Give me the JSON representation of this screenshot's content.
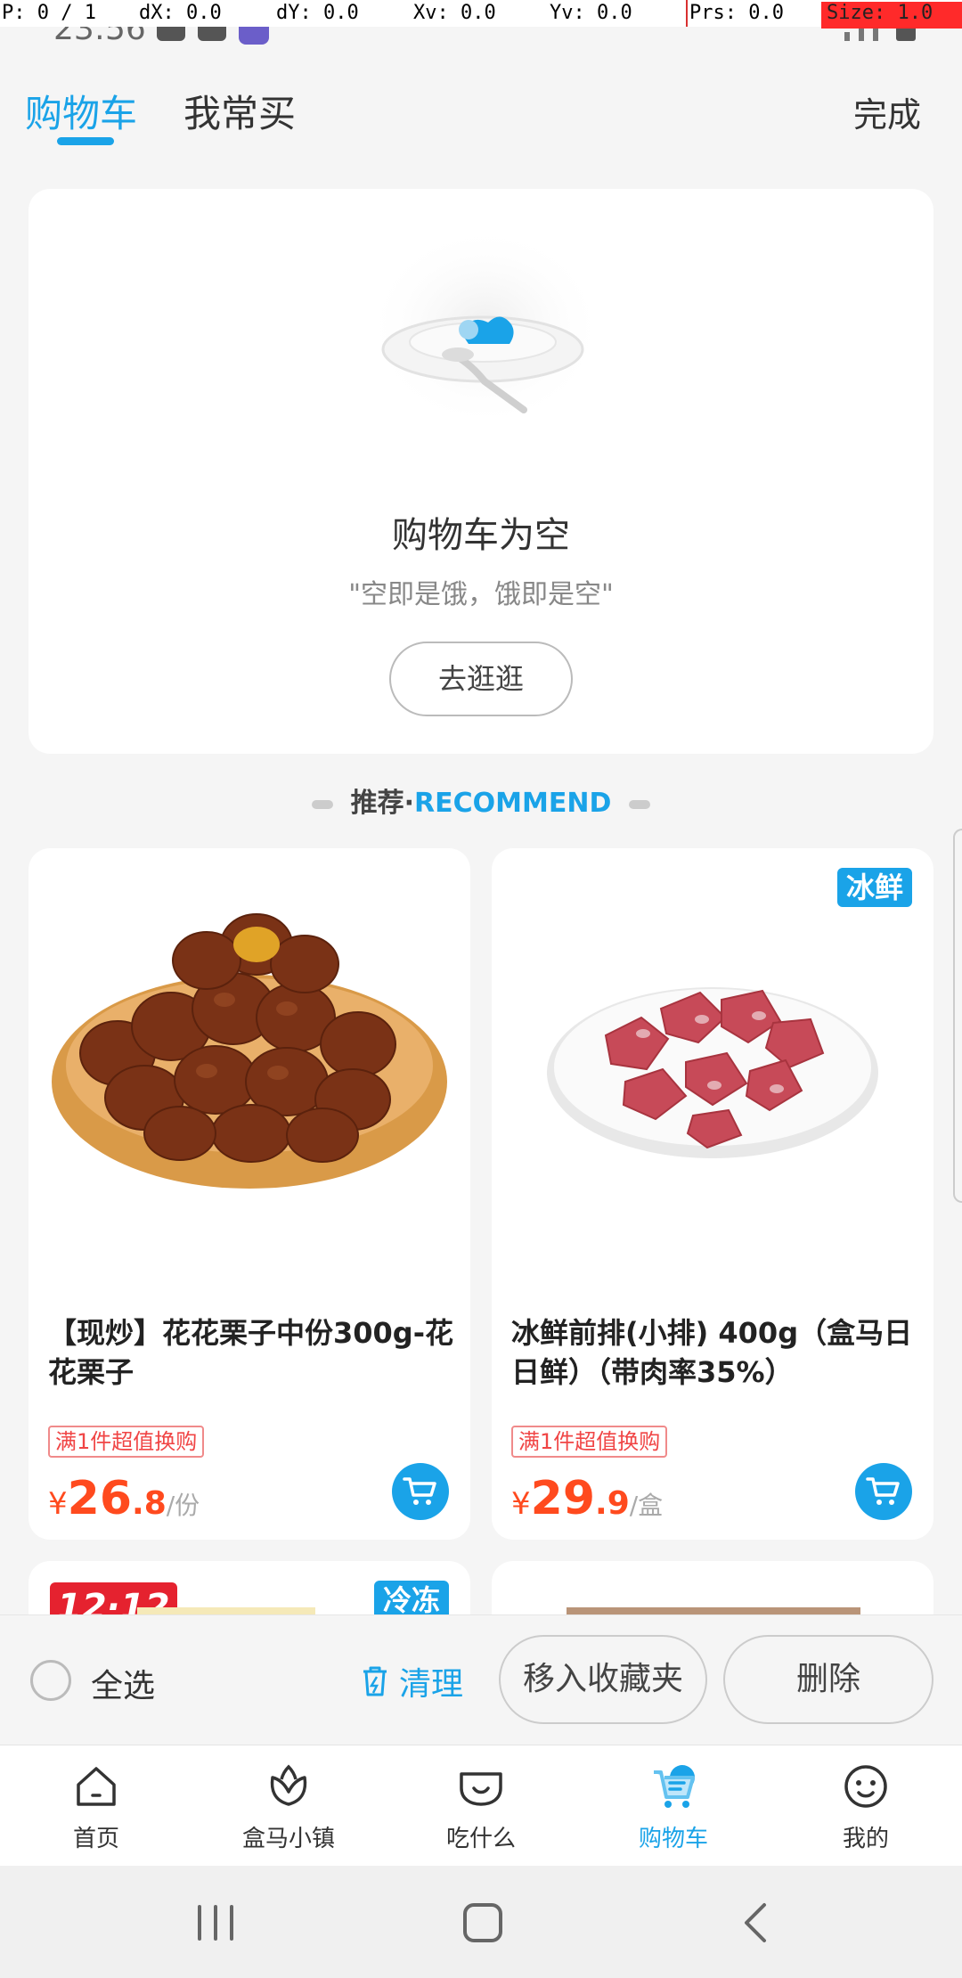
{
  "debug": {
    "p": "P: 0 / 1",
    "dx": "dX: 0.0",
    "dy": "dY: 0.0",
    "xv": "Xv: 0.0",
    "yv": "Yv: 0.0",
    "prs": "Prs: 0.0",
    "size": "Size: 1.0"
  },
  "status": {
    "time": "23:56"
  },
  "header": {
    "tab_cart": "购物车",
    "tab_frequent": "我常买",
    "done": "完成"
  },
  "empty_cart": {
    "title": "购物车为空",
    "subtitle": "\"空即是饿，饿即是空\"",
    "browse_button": "去逛逛"
  },
  "recommend": {
    "label_cn": "推荐·",
    "label_en": "RECOMMEND"
  },
  "products": [
    {
      "name": "【现炒】花花栗子中份300g-花花栗子",
      "promo": "满1件超值换购",
      "currency": "¥",
      "price_int": "26",
      "price_dec": ".8",
      "unit": "/份",
      "image_icon": "chestnut-image"
    },
    {
      "name": "冰鲜前排(小排) 400g（盒马日日鲜）（带肉率35%）",
      "badge": "冰鲜",
      "promo": "满1件超值换购",
      "currency": "¥",
      "price_int": "29",
      "price_dec": ".9",
      "unit": "/盒",
      "image_icon": "pork-ribs-image"
    },
    {
      "tag": "12·12",
      "badge": "冷冻"
    },
    {}
  ],
  "action_bar": {
    "select_all": "全选",
    "clean": "清理",
    "move_to_favorites": "移入收藏夹",
    "delete": "删除"
  },
  "bottom_nav": [
    {
      "label": "首页",
      "icon": "home-icon"
    },
    {
      "label": "盒马小镇",
      "icon": "town-icon"
    },
    {
      "label": "吃什么",
      "icon": "eat-icon"
    },
    {
      "label": "购物车",
      "icon": "cart-icon",
      "active": true
    },
    {
      "label": "我的",
      "icon": "profile-icon"
    }
  ],
  "colors": {
    "accent": "#1aa3e8",
    "price": "#ff4a1e",
    "promo_border": "#f08a8a",
    "tag_red": "#e5222f"
  }
}
